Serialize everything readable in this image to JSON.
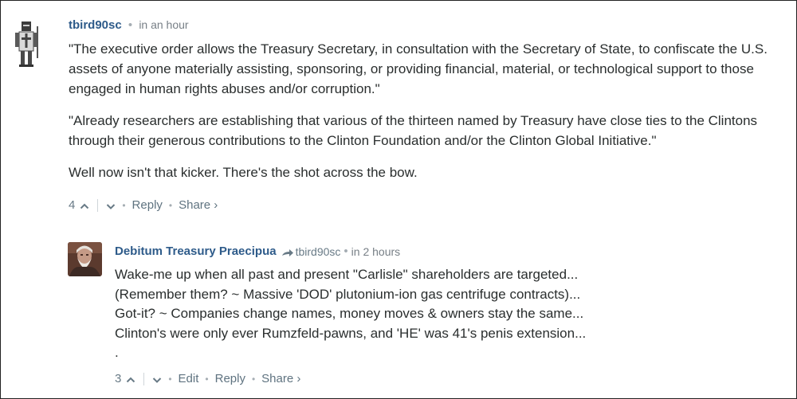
{
  "comments": [
    {
      "author": "tbird90sc",
      "time": "in an hour",
      "paragraphs": [
        "\"The executive order allows the Treasury Secretary, in consultation with the Secretary of State, to confiscate the U.S. assets of anyone materially assisting, sponsoring, or providing financial, material, or technological support to those engaged in human rights abuses and/or corruption.\"",
        "\"Already researchers are establishing that various of the thirteen named by Treasury have close ties to the Clintons through their generous contributions to the Clinton Foundation and/or the Clinton Global Initiative.\"",
        "Well now isn't that kicker. There's the shot across the bow."
      ],
      "votes": "4",
      "actions": {
        "reply": "Reply",
        "share": "Share ›"
      }
    },
    {
      "author": "Debitum Treasury Praecipua",
      "in_reply_to": "tbird90sc",
      "time": "in 2 hours",
      "lines": [
        "Wake-me up when all past and present \"Carlisle\" shareholders are targeted...",
        "(Remember them? ~ Massive 'DOD' plutonium-ion gas centrifuge contracts)...",
        "Got-it? ~ Companies change names, money moves & owners stay the same...",
        "Clinton's were only ever Rumzfeld-pawns, and 'HE' was 41's penis extension...",
        "."
      ],
      "votes": "3",
      "actions": {
        "edit": "Edit",
        "reply": "Reply",
        "share": "Share ›"
      }
    }
  ],
  "icons": {
    "upvote": "chevron-up-icon",
    "downvote": "chevron-down-icon",
    "reply_arrow": "reply-arrow-icon"
  },
  "colors": {
    "author": "#2e5b8a",
    "meta": "#777f86",
    "text": "#2a2e2e"
  }
}
